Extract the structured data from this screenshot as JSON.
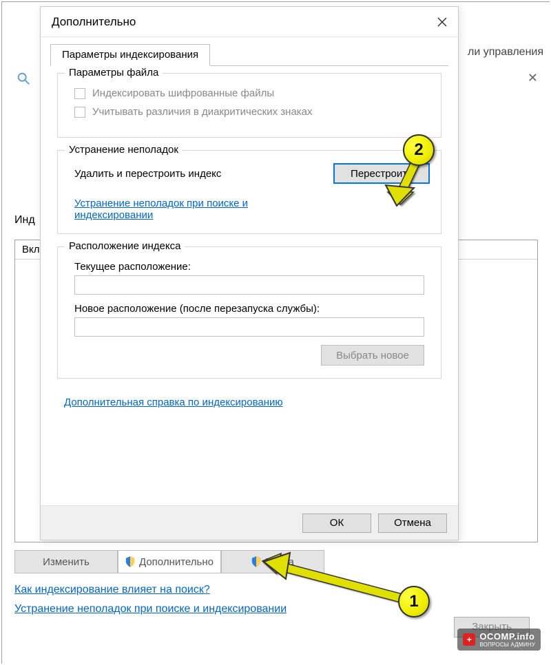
{
  "bg_window": {
    "right_text": "ли управления",
    "close_x": "✕",
    "label_ind": "Инд",
    "table_header": "Вкл",
    "buttons": {
      "change": "Изменить",
      "advanced": "Дополнительно",
      "pause": "Пауза"
    },
    "links": {
      "how_affects": "Как индексирование влияет на поиск?",
      "troubleshoot": "Устранение неполадок при поиске и индексировании"
    },
    "close_button": "Закрыть"
  },
  "dialog": {
    "title": "Дополнительно",
    "tab": "Параметры индексирования",
    "group_file": {
      "legend": "Параметры файла",
      "cb_encrypted": "Индексировать шифрованные файлы",
      "cb_diacritics": "Учитывать различия в диакритических знаках"
    },
    "group_troubleshoot": {
      "legend": "Устранение неполадок",
      "delete_label": "Удалить и перестроить индекс",
      "rebuild_button": "Перестроить",
      "link": "Устранение неполадок при поиске и индексировании"
    },
    "group_location": {
      "legend": "Расположение индекса",
      "current_label": "Текущее расположение:",
      "new_label": "Новое расположение (после перезапуска службы):",
      "choose_button": "Выбрать новое"
    },
    "help_link": "Дополнительная справка по индексированию",
    "footer": {
      "ok": "ОК",
      "cancel": "Отмена"
    }
  },
  "annotations": {
    "balloon1": "1",
    "balloon2": "2"
  },
  "watermark": {
    "top": "OCOMP.info",
    "sub": "ВОПРОСЫ АДМИНУ"
  }
}
